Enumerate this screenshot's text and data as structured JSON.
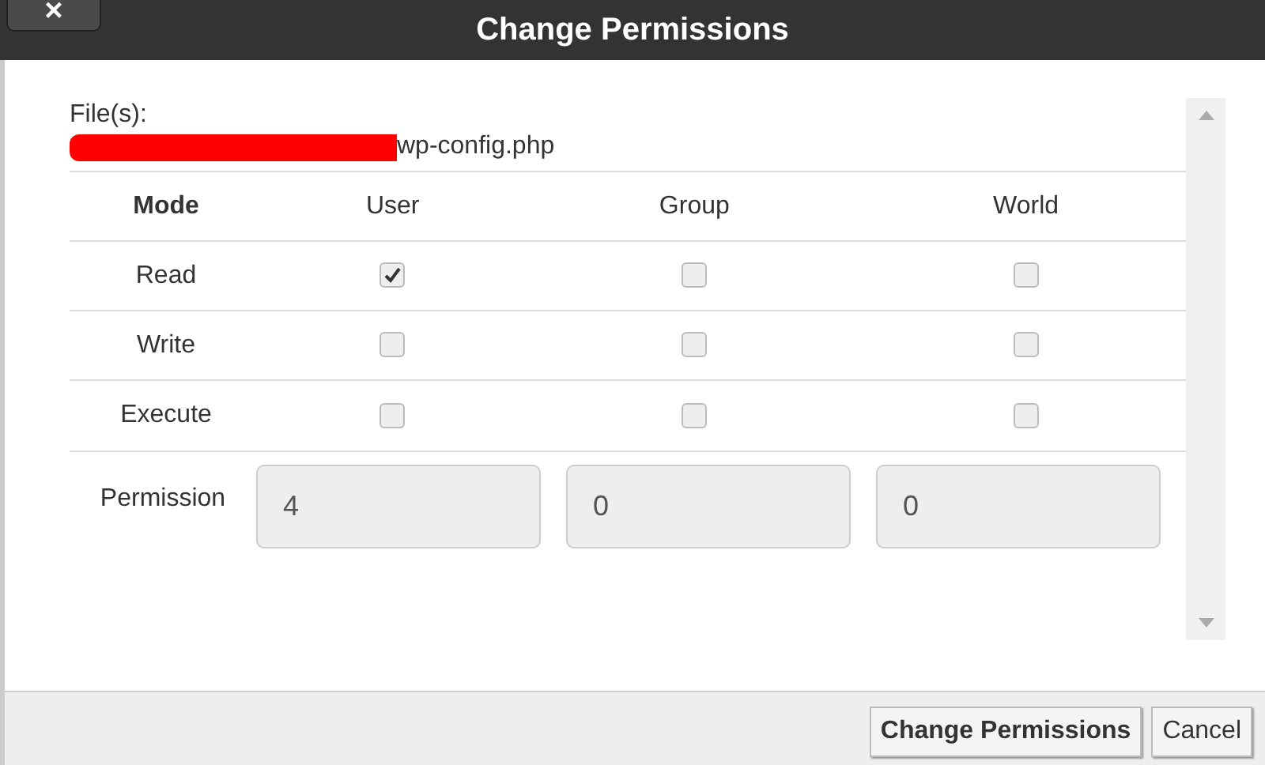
{
  "window": {
    "title": "Change Permissions",
    "close_label": "×"
  },
  "files": {
    "label": "File(s):",
    "path": "wp-config.php",
    "redacted": true
  },
  "table": {
    "columns": [
      "Mode",
      "User",
      "Group",
      "World"
    ],
    "rows": [
      {
        "label": "Read",
        "checks": [
          {
            "checked": true
          },
          {
            "checked": false
          },
          {
            "checked": false
          }
        ]
      },
      {
        "label": "Write",
        "checks": [
          {
            "checked": false
          },
          {
            "checked": false
          },
          {
            "checked": false
          }
        ]
      },
      {
        "label": "Execute",
        "checks": [
          {
            "checked": false
          },
          {
            "checked": false
          },
          {
            "checked": false
          }
        ]
      }
    ]
  },
  "permission": {
    "label": "Permission",
    "values": [
      "4",
      "0",
      "0"
    ]
  },
  "buttons": [
    {
      "label": "Change Permissions",
      "primary": true
    },
    {
      "label": "Cancel",
      "primary": false
    }
  ]
}
